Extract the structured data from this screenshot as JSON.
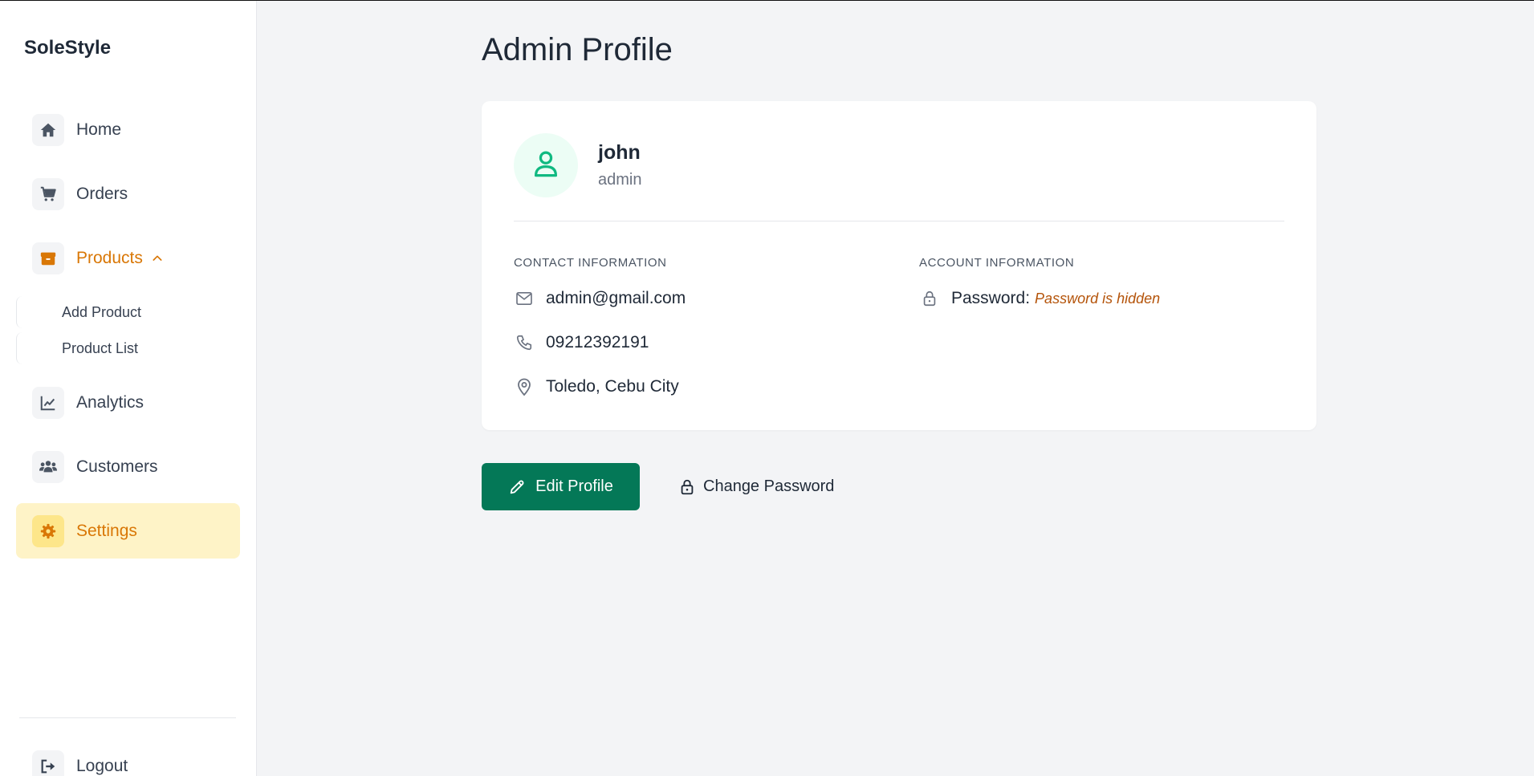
{
  "app": {
    "brand": "SoleStyle"
  },
  "sidebar": {
    "items": [
      {
        "label": "Home",
        "icon": "home-icon"
      },
      {
        "label": "Orders",
        "icon": "cart-icon"
      },
      {
        "label": "Products",
        "icon": "box-icon",
        "expanded": true
      },
      {
        "label": "Analytics",
        "icon": "chart-line-icon"
      },
      {
        "label": "Customers",
        "icon": "users-icon"
      },
      {
        "label": "Settings",
        "icon": "gear-icon",
        "active": true
      }
    ],
    "subitems": [
      {
        "label": "Add Product"
      },
      {
        "label": "Product List"
      }
    ],
    "logout": {
      "label": "Logout",
      "icon": "logout-icon"
    }
  },
  "main": {
    "title": "Admin Profile",
    "profile": {
      "name": "john",
      "role": "admin"
    },
    "contact": {
      "heading": "CONTACT INFORMATION",
      "email": "admin@gmail.com",
      "phone": "09212392191",
      "address": "Toledo, Cebu City"
    },
    "account": {
      "heading": "ACCOUNT INFORMATION",
      "password_label": "Password:",
      "password_value": "Password is hidden"
    },
    "actions": {
      "edit_label": "Edit Profile",
      "change_password_label": "Change Password"
    }
  },
  "colors": {
    "accent": "#d97706",
    "primary_button": "#047857",
    "active_bg": "#fef3c7",
    "avatar_bg": "#ecfdf5"
  }
}
